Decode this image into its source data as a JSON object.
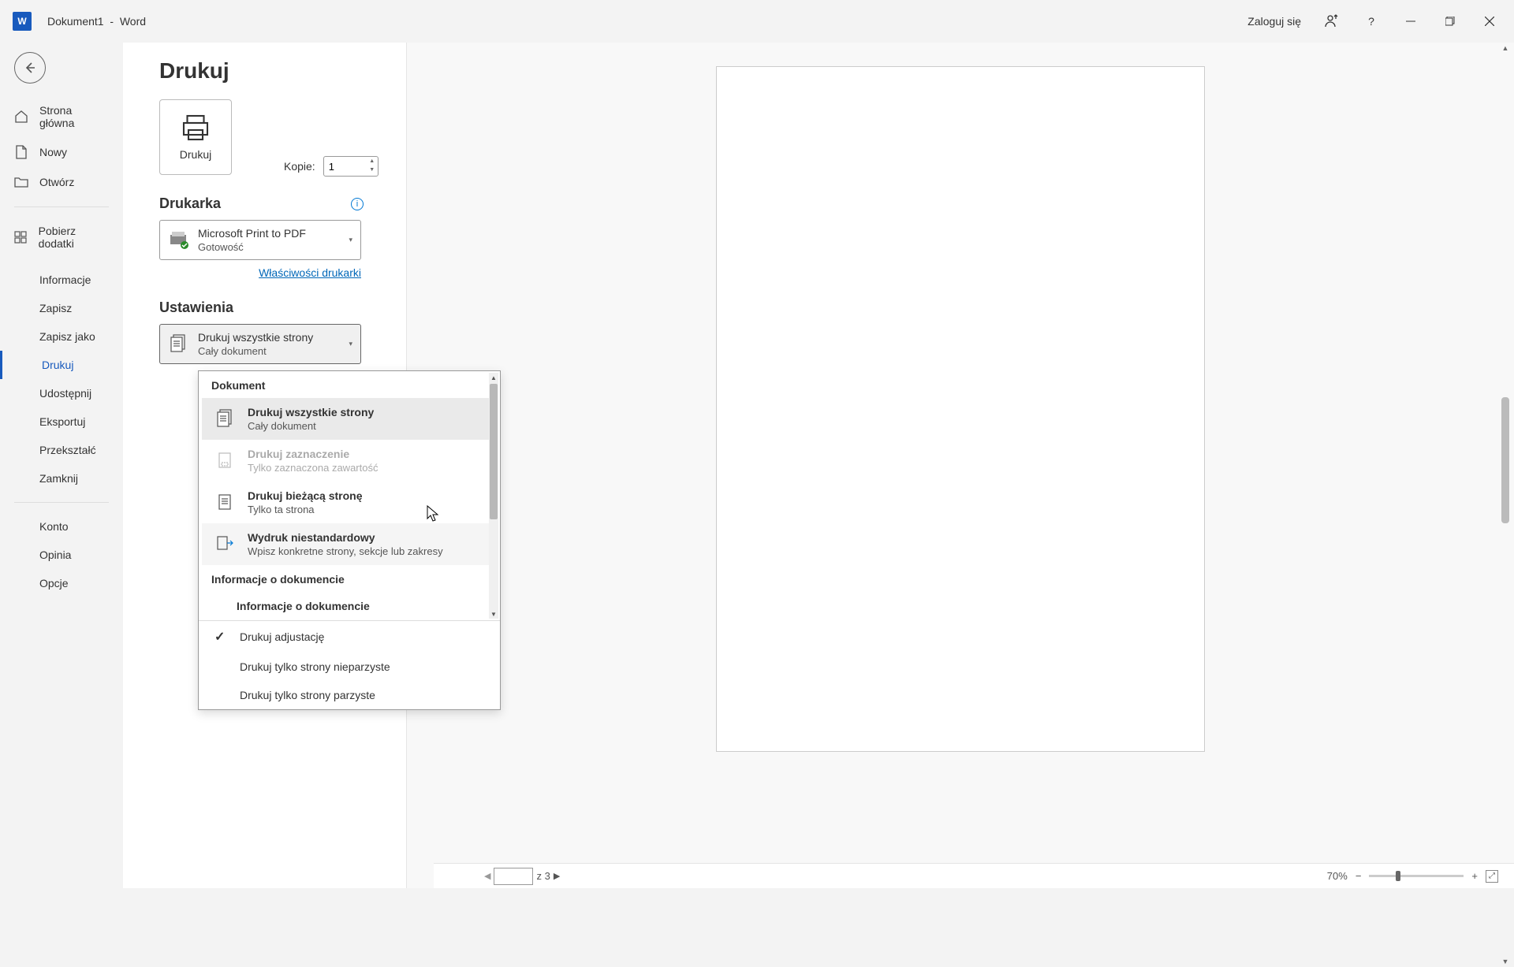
{
  "titlebar": {
    "doc_name": "Dokument1",
    "app_sep": "-",
    "app_name": "Word",
    "signin": "Zaloguj się"
  },
  "sidebar": {
    "home": "Strona główna",
    "new": "Nowy",
    "open": "Otwórz",
    "addins": "Pobierz dodatki",
    "info": "Informacje",
    "save": "Zapisz",
    "saveas": "Zapisz jako",
    "print": "Drukuj",
    "share": "Udostępnij",
    "export": "Eksportuj",
    "transform": "Przekształć",
    "close": "Zamknij",
    "account": "Konto",
    "feedback": "Opinia",
    "options": "Opcje"
  },
  "print": {
    "title": "Drukuj",
    "button_label": "Drukuj",
    "copies_label": "Kopie:",
    "copies_value": "1",
    "printer_section": "Drukarka",
    "printer_name": "Microsoft Print to PDF",
    "printer_status": "Gotowość",
    "printer_props": "Właściwości drukarki",
    "settings_section": "Ustawienia",
    "what_line1": "Drukuj wszystkie strony",
    "what_line2": "Cały dokument"
  },
  "popup": {
    "header1": "Dokument",
    "item1_t1": "Drukuj wszystkie strony",
    "item1_t2": "Cały dokument",
    "item2_t1": "Drukuj zaznaczenie",
    "item2_t2": "Tylko zaznaczona zawartość",
    "item3_t1": "Drukuj bieżącą stronę",
    "item3_t2": "Tylko ta strona",
    "item4_t1": "Wydruk niestandardowy",
    "item4_t2": "Wpisz konkretne strony, sekcje lub zakresy",
    "header2": "Informacje o dokumencie",
    "item5_t1": "Informacje o dokumencie",
    "chk1": "Drukuj adjustację",
    "chk2": "Drukuj tylko strony nieparzyste",
    "chk3": "Drukuj tylko strony parzyste"
  },
  "statusbar": {
    "page_of": "z 3",
    "zoom": "70%"
  }
}
